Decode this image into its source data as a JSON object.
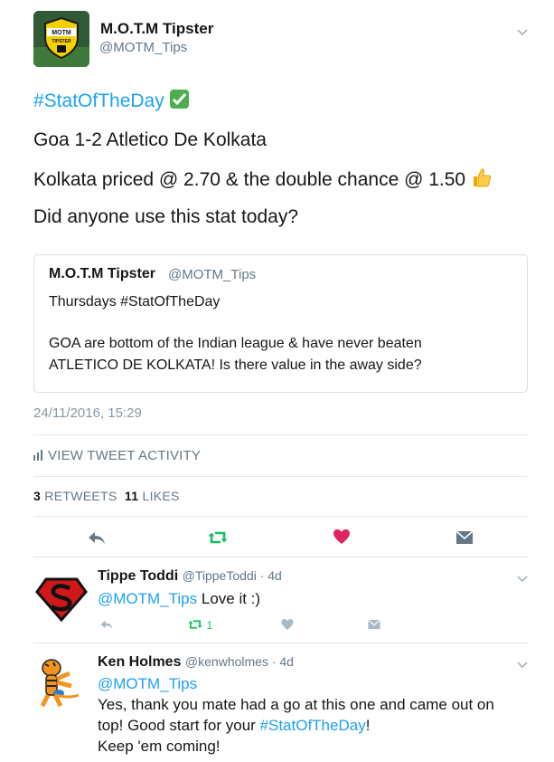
{
  "tweet": {
    "author_name": "M.O.T.M Tipster",
    "author_handle": "@MOTM_Tips",
    "avatar_text_top": "MOTM",
    "avatar_text_bottom": "TIPSTER",
    "hashtag": "#StatOfTheDay",
    "line2": "Goa 1-2 Atletico De Kolkata",
    "line3": "Kolkata priced @ 2.70 & the double chance @ 1.50",
    "line4": "Did anyone use this stat today?",
    "timestamp": "24/11/2016, 15:29",
    "activity_label": "VIEW TWEET ACTIVITY",
    "retweets_count": "3",
    "retweets_label": "RETWEETS",
    "likes_count": "11",
    "likes_label": "LIKES"
  },
  "quote": {
    "author_name": "M.O.T.M Tipster",
    "author_handle": "@MOTM_Tips",
    "line1": "Thursdays #StatOfTheDay",
    "line2": "GOA are bottom of the Indian league & have never beaten",
    "line3": "ATLETICO DE KOLKATA! Is there value in the away side?"
  },
  "replies": [
    {
      "name": "Tippe Toddi",
      "handle": "@TippeToddi · 4d",
      "mention": "@MOTM_Tips",
      "text": " Love it :)",
      "retweet_count": "1"
    },
    {
      "name": "Ken Holmes",
      "handle": "@kenwholmes · 4d",
      "mention": "@MOTM_Tips",
      "line1": "Yes, thank you mate had a go at this one and came out on",
      "line2_prefix": "top! Good start for your ",
      "line2_hashtag": "#StatOfTheDay",
      "line2_suffix": "!",
      "line3": "Keep 'em coming!"
    }
  ],
  "colors": {
    "accent": "#1da1f2",
    "retweet": "#17bf63",
    "like": "#e0245e",
    "muted": "#657786"
  },
  "icons": [
    "chevron-down-icon",
    "check-emoji-icon",
    "thumbs-up-emoji-icon",
    "bar-chart-icon",
    "reply-icon",
    "retweet-icon",
    "heart-icon",
    "direct-message-icon"
  ]
}
